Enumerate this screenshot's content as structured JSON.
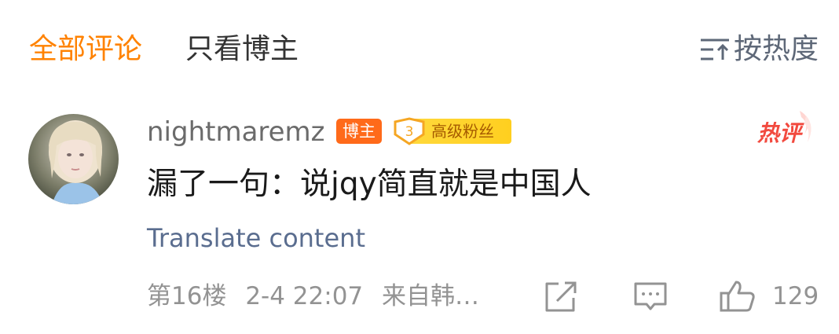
{
  "tabs": {
    "all_comments": "全部评论",
    "blogger_only": "只看博主",
    "sort_label": "按热度"
  },
  "comment": {
    "username": "nightmaremz",
    "blogger_badge": "博主",
    "fan_badge_level": "3",
    "fan_badge_label": "高级粉丝",
    "hot_label": "热评",
    "text": "漏了一句：说jqy简直就是中国人",
    "translate": "Translate content",
    "floor": "第16楼",
    "time": "2-4 22:07",
    "source": "来自韩…",
    "like_count": "129"
  },
  "colors": {
    "accent": "#ff8200",
    "blogger_badge": "#ff6a1a",
    "fan_badge": "#ffd93d",
    "link": "#5a6d8f",
    "meta": "#939393"
  },
  "icons": {
    "sort": "sort-lines-icon",
    "share": "share-icon",
    "comment": "comment-icon",
    "like": "thumbs-up-icon",
    "hot": "hot-comment-icon"
  }
}
